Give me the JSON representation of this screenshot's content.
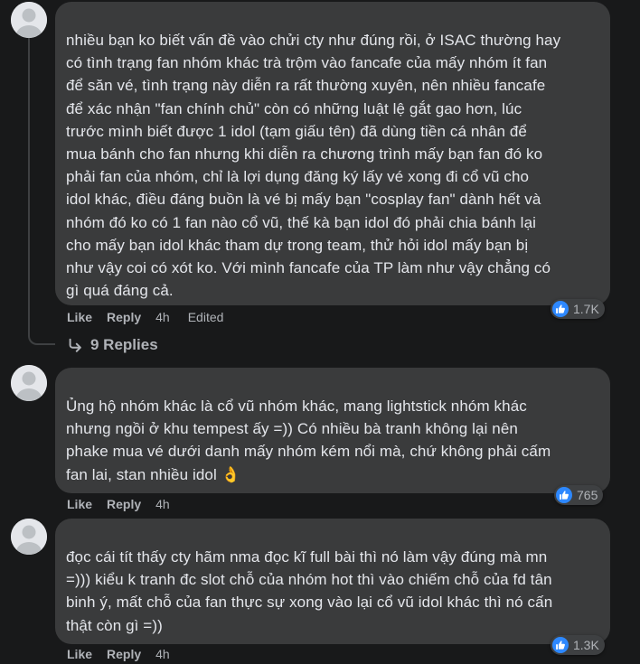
{
  "comments": [
    {
      "text": "nhiều bạn ko biết vấn đề vào chửi cty như đúng rồi, ở ISAC thường hay\ncó tình trạng fan nhóm khác trà trộm vào fancafe của mấy nhóm ít fan\nđể săn vé, tình trạng này diễn ra rất thường xuyên, nên nhiều fancafe\nđể xác nhận \"fan chính chủ\" còn có những luật lệ gắt gao hơn, lúc\ntrước mình biết được 1 idol (tạm giấu tên) đã dùng tiền cá nhân để\nmua bánh cho fan nhưng khi diễn ra chương trình mấy bạn fan đó ko\nphải fan của nhóm, chỉ là lợi dụng đăng ký lấy vé xong đi cổ vũ cho\nidol khác, điều đáng buồn là vé bị mấy bạn \"cosplay fan\" dành hết và\nnhóm đó ko có 1 fan nào cổ vũ, thế kà bạn idol đó phải chia bánh lại\ncho mấy bạn idol khác tham dự trong team, thử hỏi idol mấy bạn bị\nnhư vậy coi có xót ko. Với mình fancafe của TP làm như vậy chẳng có\ngì quá đáng cả.",
      "like_label": "Like",
      "reply_label": "Reply",
      "time": "4h",
      "edited": "Edited",
      "reaction_count": "1.7K",
      "replies_label": "9 Replies"
    },
    {
      "text": "Ủng hộ nhóm khác là cổ vũ nhóm khác, mang lightstick nhóm khác\nnhưng ngồi ở khu tempest ấy =)) Có nhiều bà tranh không lại nên\nphake mua vé dưới danh mấy nhóm kém nổi mà, chứ không phải cấm\nfan lai, stan nhiều idol",
      "emoji": "👌",
      "like_label": "Like",
      "reply_label": "Reply",
      "time": "4h",
      "reaction_count": "765"
    },
    {
      "text": "đọc cái tít thấy cty hãm nma đọc kĩ full bài thì nó làm vậy đúng mà mn\n=))) kiểu k tranh đc slot chỗ của nhóm hot thì vào chiếm chỗ của fd tân\nbinh ý, mất chỗ của fan thực sự xong vào lại cổ vũ idol khác thì nó cấn\nthật còn gì =))",
      "like_label": "Like",
      "reply_label": "Reply",
      "time": "4h",
      "reaction_count": "1.3K"
    }
  ],
  "icons": {
    "avatar": "default-avatar-icon",
    "like": "thumbs-up-icon",
    "reply_arrow": "reply-arrow-icon"
  },
  "colors": {
    "background": "#18191a",
    "bubble": "#3a3b3c",
    "text": "#e4e6eb",
    "secondary_text": "#b0b3b8",
    "like_blue": "#2d88ff"
  }
}
